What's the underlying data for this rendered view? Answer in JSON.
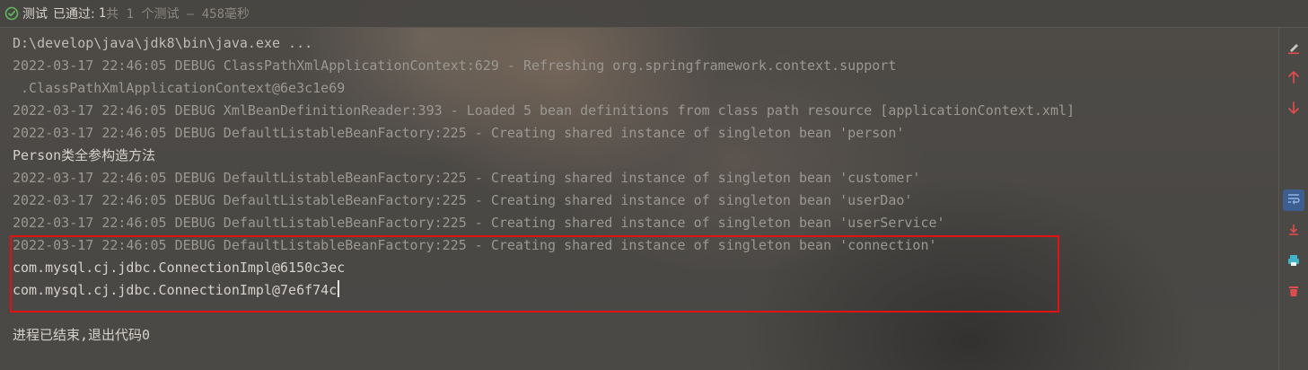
{
  "header": {
    "status": "测试",
    "passed_label": "已通过:",
    "passed_count": "1",
    "summary": "共 1 个测试 – 458毫秒"
  },
  "console": {
    "lines": [
      {
        "type": "cmd",
        "text": "D:\\develop\\java\\jdk8\\bin\\java.exe ..."
      },
      {
        "type": "debug",
        "text": "2022-03-17 22:46:05 DEBUG ClassPathXmlApplicationContext:629 - Refreshing org.springframework.context.support"
      },
      {
        "type": "debug",
        "text": " .ClassPathXmlApplicationContext@6e3c1e69"
      },
      {
        "type": "debug",
        "text": "2022-03-17 22:46:05 DEBUG XmlBeanDefinitionReader:393 - Loaded 5 bean definitions from class path resource [applicationContext.xml]"
      },
      {
        "type": "debug",
        "text": "2022-03-17 22:46:05 DEBUG DefaultListableBeanFactory:225 - Creating shared instance of singleton bean 'person'"
      },
      {
        "type": "plain",
        "text": "Person类全参构造方法"
      },
      {
        "type": "debug",
        "text": "2022-03-17 22:46:05 DEBUG DefaultListableBeanFactory:225 - Creating shared instance of singleton bean 'customer'"
      },
      {
        "type": "debug",
        "text": "2022-03-17 22:46:05 DEBUG DefaultListableBeanFactory:225 - Creating shared instance of singleton bean 'userDao'"
      },
      {
        "type": "debug",
        "text": "2022-03-17 22:46:05 DEBUG DefaultListableBeanFactory:225 - Creating shared instance of singleton bean 'userService'"
      },
      {
        "type": "debug",
        "text": "2022-03-17 22:46:05 DEBUG DefaultListableBeanFactory:225 - Creating shared instance of singleton bean 'connection'"
      },
      {
        "type": "plain",
        "text": "com.mysql.cj.jdbc.ConnectionImpl@6150c3ec"
      },
      {
        "type": "plain",
        "text": "com.mysql.cj.jdbc.ConnectionImpl@7e6f74c"
      },
      {
        "type": "blank",
        "text": ""
      },
      {
        "type": "plain",
        "text": "进程已结束,退出代码0"
      }
    ]
  },
  "toolbar": {
    "icons": [
      "clear-icon",
      "up-arrow-icon",
      "down-arrow-icon",
      "soft-wrap-icon",
      "scroll-to-end-icon",
      "print-icon",
      "delete-icon"
    ]
  },
  "colors": {
    "accent_red": "#e01212",
    "success_green": "#5fb760",
    "active_blue": "#3d5f8f"
  }
}
